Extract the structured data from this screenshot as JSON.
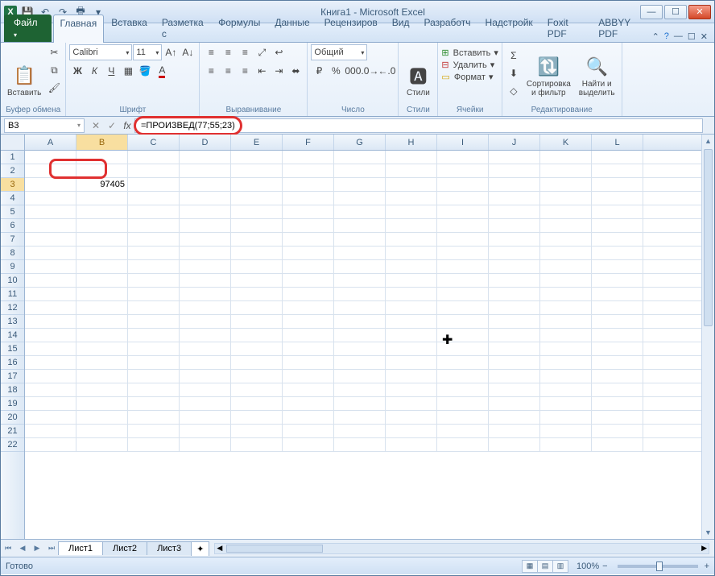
{
  "titlebar": {
    "title": "Книга1 - Microsoft Excel"
  },
  "tabs": {
    "file": "Файл",
    "items": [
      "Главная",
      "Вставка",
      "Разметка с",
      "Формулы",
      "Данные",
      "Рецензиров",
      "Вид",
      "Разработч",
      "Надстройк",
      "Foxit PDF",
      "ABBYY PDF"
    ],
    "active_index": 0
  },
  "ribbon": {
    "clipboard": {
      "label": "Буфер обмена",
      "paste": "Вставить"
    },
    "font": {
      "label": "Шрифт",
      "name": "Calibri",
      "size": "11"
    },
    "align": {
      "label": "Выравнивание"
    },
    "number": {
      "label": "Число",
      "format": "Общий"
    },
    "styles": {
      "label": "Стили",
      "btn": "Стили"
    },
    "cells": {
      "label": "Ячейки",
      "insert": "Вставить",
      "delete": "Удалить",
      "format": "Формат"
    },
    "editing": {
      "label": "Редактирование",
      "sort": "Сортировка\nи фильтр",
      "find": "Найти и\nвыделить"
    }
  },
  "formula_bar": {
    "namebox": "B3",
    "formula": "=ПРОИЗВЕД(77;55;23)"
  },
  "grid": {
    "columns": [
      "A",
      "B",
      "C",
      "D",
      "E",
      "F",
      "G",
      "H",
      "I",
      "J",
      "K",
      "L"
    ],
    "rows": 22,
    "active_col": 1,
    "active_row": 2,
    "cells": {
      "B3": "97405"
    }
  },
  "sheets": {
    "items": [
      "Лист1",
      "Лист2",
      "Лист3"
    ],
    "active_index": 0
  },
  "statusbar": {
    "status": "Готово",
    "zoom": "100%"
  },
  "colors": {
    "accent": "#e03030",
    "header": "#3b5b7a"
  }
}
